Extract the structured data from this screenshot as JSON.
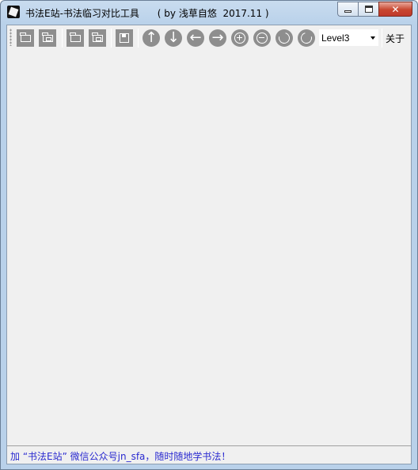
{
  "window": {
    "title": "书法E站-书法临习对比工具      ( by 浅草自悠  2017.11 )",
    "minimize_icon": "minimize-icon",
    "maximize_icon": "maximize-icon",
    "close_glyph": "✕"
  },
  "toolbar": {
    "buttons": [
      {
        "name": "open-image-button",
        "icon": "folder-open-icon"
      },
      {
        "name": "open-compare-button",
        "icon": "folder-compare-icon"
      },
      {
        "name": "open-folder-button",
        "icon": "folder-icon"
      },
      {
        "name": "open-folder-compare-button",
        "icon": "folder-compare-alt-icon"
      },
      {
        "name": "save-button",
        "icon": "save-icon"
      },
      {
        "name": "move-up-button",
        "icon": "arrow-up-icon",
        "glyph": "↑"
      },
      {
        "name": "move-down-button",
        "icon": "arrow-down-icon",
        "glyph": "↓"
      },
      {
        "name": "move-left-button",
        "icon": "arrow-left-icon",
        "glyph": "←"
      },
      {
        "name": "move-right-button",
        "icon": "arrow-right-icon",
        "glyph": "→"
      },
      {
        "name": "zoom-in-button",
        "icon": "zoom-in-icon"
      },
      {
        "name": "zoom-out-button",
        "icon": "zoom-out-icon"
      },
      {
        "name": "rotate-cw-button",
        "icon": "rotate-cw-icon"
      },
      {
        "name": "rotate-ccw-button",
        "icon": "rotate-ccw-icon"
      }
    ],
    "level_select": {
      "selected": "Level3"
    },
    "about_label": "关于"
  },
  "statusbar": {
    "text": "加 “书法E站” 微信公众号jn_sfa，随时随地学书法！"
  },
  "colors": {
    "title_gradient": "#b9d1ea",
    "client_bg": "#f0f0f0",
    "toolbar_button": "#8e8e8e",
    "status_text": "#2a2ad0",
    "close_button": "#c8462f"
  }
}
